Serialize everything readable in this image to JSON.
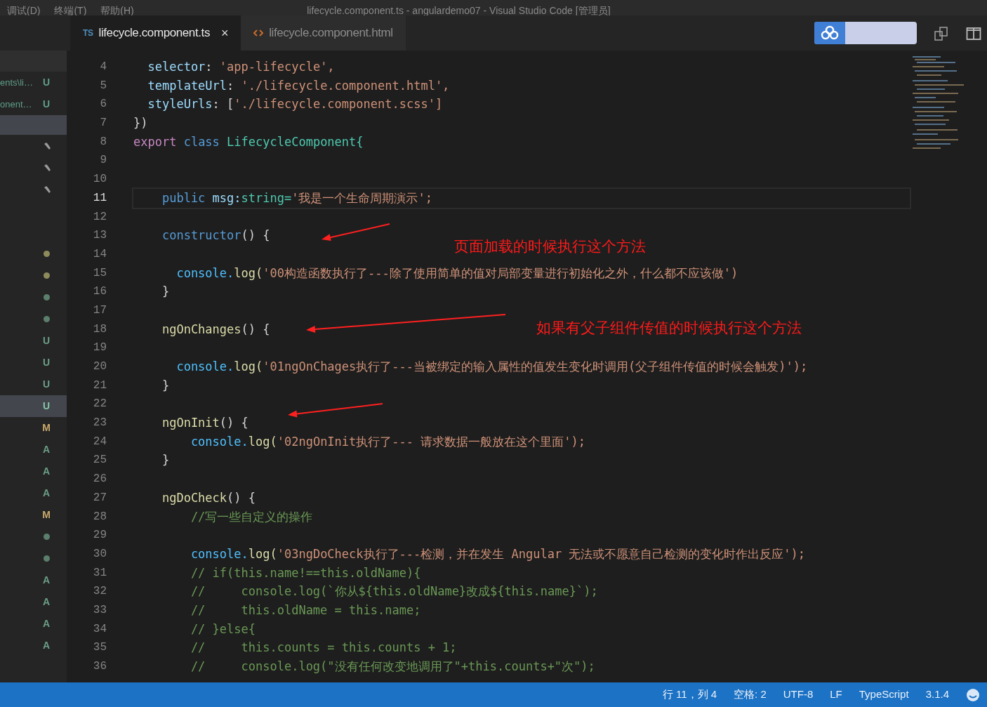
{
  "window": {
    "menus": [
      "调试(D)",
      "终端(T)",
      "帮助(H)"
    ],
    "title": "lifecycle.component.ts - angulardemo07 - Visual Studio Code [管理员]"
  },
  "tabs": [
    {
      "kind": "ts",
      "icon_text": "TS",
      "label": "lifecycle.component.ts",
      "close": "×",
      "selected": true
    },
    {
      "kind": "html",
      "label": "lifecycle.component.html",
      "selected": false
    }
  ],
  "sidebar": {
    "items": [
      {
        "kind": "file",
        "label": "ents\\li…",
        "badge": "U",
        "selected": false
      },
      {
        "kind": "file",
        "label": "onent…",
        "badge": "U",
        "selected": false
      },
      {
        "kind": "blank",
        "selected": true
      },
      {
        "kind": "icon",
        "selected": false
      },
      {
        "kind": "icon",
        "selected": false
      },
      {
        "kind": "icon",
        "selected": false
      }
    ],
    "changes": [
      {
        "kind": "dot",
        "color": "#8d8a5c",
        "selected": false
      },
      {
        "kind": "dot",
        "color": "#8d8a5c",
        "selected": false
      },
      {
        "kind": "dot",
        "color": "#5b7f6c",
        "selected": false
      },
      {
        "kind": "dot",
        "color": "#5b7f6c",
        "selected": false
      },
      {
        "kind": "letter",
        "text": "U",
        "color": "#6b9f86",
        "selected": false
      },
      {
        "kind": "letter",
        "text": "U",
        "color": "#6b9f86",
        "selected": false
      },
      {
        "kind": "letter",
        "text": "U",
        "color": "#6b9f86",
        "selected": false
      },
      {
        "kind": "letter",
        "text": "U",
        "color": "#6b9f86",
        "selected": true
      },
      {
        "kind": "letter",
        "text": "M",
        "color": "#c9a96a",
        "selected": false
      },
      {
        "kind": "letter",
        "text": "A",
        "color": "#6b9f86",
        "selected": false
      },
      {
        "kind": "letter",
        "text": "A",
        "color": "#6b9f86",
        "selected": false
      },
      {
        "kind": "letter",
        "text": "A",
        "color": "#6b9f86",
        "selected": false
      },
      {
        "kind": "letter",
        "text": "M",
        "color": "#c9a96a",
        "selected": false
      },
      {
        "kind": "dot",
        "color": "#5b7f6c",
        "selected": false
      },
      {
        "kind": "dot",
        "color": "#5b7f6c",
        "selected": false
      },
      {
        "kind": "letter",
        "text": "A",
        "color": "#6b9f86",
        "selected": false
      },
      {
        "kind": "letter",
        "text": "A",
        "color": "#6b9f86",
        "selected": false
      },
      {
        "kind": "letter",
        "text": "A",
        "color": "#6b9f86",
        "selected": false
      },
      {
        "kind": "letter",
        "text": "A",
        "color": "#6b9f86",
        "selected": false
      }
    ]
  },
  "editor": {
    "lines": [
      {
        "number": "4",
        "current": false,
        "tokens": [
          {
            "kind": "attr",
            "text": "  selector"
          },
          {
            "kind": "plain",
            "text": ": "
          },
          {
            "kind": "string",
            "text": "'app-lifecycle',"
          }
        ]
      },
      {
        "number": "5",
        "current": false,
        "tokens": [
          {
            "kind": "attr",
            "text": "  templateUrl"
          },
          {
            "kind": "plain",
            "text": ": "
          },
          {
            "kind": "string",
            "text": "'./lifecycle.component.html',"
          }
        ]
      },
      {
        "number": "6",
        "current": false,
        "tokens": [
          {
            "kind": "attr",
            "text": "  styleUrls"
          },
          {
            "kind": "plain",
            "text": ": ["
          },
          {
            "kind": "string",
            "text": "'./lifecycle.component.scss']"
          }
        ]
      },
      {
        "number": "7",
        "current": false,
        "tokens": [
          {
            "kind": "plain",
            "text": "})"
          }
        ]
      },
      {
        "number": "8",
        "current": false,
        "tokens": [
          {
            "kind": "control",
            "text": "export "
          },
          {
            "kind": "keyword",
            "text": "class "
          },
          {
            "kind": "type",
            "text": "LifecycleComponent{"
          }
        ]
      },
      {
        "number": "9",
        "current": false
      },
      {
        "number": "10",
        "current": false
      },
      {
        "number": "11",
        "current": true,
        "tokens": [
          {
            "kind": "keyword",
            "text": "    public "
          },
          {
            "kind": "attr",
            "text": "msg:"
          },
          {
            "kind": "type",
            "text": "string="
          },
          {
            "kind": "string",
            "text": "'我是一个生命周期演示';"
          }
        ]
      },
      {
        "number": "12",
        "current": false
      },
      {
        "number": "13",
        "current": false,
        "tokens": [
          {
            "kind": "keyword",
            "text": "    constructor"
          },
          {
            "kind": "plain",
            "text": "() {"
          }
        ]
      },
      {
        "number": "14",
        "current": false
      },
      {
        "number": "15",
        "current": false,
        "tokens": [
          {
            "kind": "variable",
            "text": "      console."
          },
          {
            "kind": "function",
            "text": "log("
          },
          {
            "kind": "string",
            "text": "'00构造函数执行了---除了使用简单的值对局部变量进行初始化之外，什么都不应该做')"
          }
        ]
      },
      {
        "number": "16",
        "current": false,
        "tokens": [
          {
            "kind": "plain",
            "text": "    }"
          }
        ]
      },
      {
        "number": "17",
        "current": false
      },
      {
        "number": "18",
        "current": false,
        "tokens": [
          {
            "kind": "function",
            "text": "    ngOnChanges"
          },
          {
            "kind": "plain",
            "text": "() {"
          }
        ]
      },
      {
        "number": "19",
        "current": false
      },
      {
        "number": "20",
        "current": false,
        "tokens": [
          {
            "kind": "variable",
            "text": "      console."
          },
          {
            "kind": "function",
            "text": "log("
          },
          {
            "kind": "string",
            "text": "'01ngOnChages执行了---当被绑定的输入属性的值发生变化时调用(父子组件传值的时候会触发)');"
          }
        ]
      },
      {
        "number": "21",
        "current": false,
        "tokens": [
          {
            "kind": "plain",
            "text": "    }"
          }
        ]
      },
      {
        "number": "22",
        "current": false
      },
      {
        "number": "23",
        "current": false,
        "tokens": [
          {
            "kind": "function",
            "text": "    ngOnInit"
          },
          {
            "kind": "plain",
            "text": "() {"
          }
        ]
      },
      {
        "number": "24",
        "current": false,
        "tokens": [
          {
            "kind": "variable",
            "text": "        console."
          },
          {
            "kind": "function",
            "text": "log("
          },
          {
            "kind": "string",
            "text": "'02ngOnInit执行了--- 请求数据一般放在这个里面');"
          }
        ]
      },
      {
        "number": "25",
        "current": false,
        "tokens": [
          {
            "kind": "plain",
            "text": "    }"
          }
        ]
      },
      {
        "number": "26",
        "current": false
      },
      {
        "number": "27",
        "current": false,
        "tokens": [
          {
            "kind": "function",
            "text": "    ngDoCheck"
          },
          {
            "kind": "plain",
            "text": "() {"
          }
        ]
      },
      {
        "number": "28",
        "current": false,
        "tokens": [
          {
            "kind": "comment",
            "text": "        //写一些自定义的操作"
          }
        ]
      },
      {
        "number": "29",
        "current": false
      },
      {
        "number": "30",
        "current": false,
        "tokens": [
          {
            "kind": "variable",
            "text": "        console."
          },
          {
            "kind": "function",
            "text": "log("
          },
          {
            "kind": "string",
            "text": "'03ngDoCheck执行了---检测，并在发生 Angular 无法或不愿意自己检测的变化时作出反应');"
          }
        ]
      },
      {
        "number": "31",
        "current": false,
        "tokens": [
          {
            "kind": "comment",
            "text": "        // if(this.name!==this.oldName){"
          }
        ]
      },
      {
        "number": "32",
        "current": false,
        "tokens": [
          {
            "kind": "comment",
            "text": "        //     console.log(`你从${this.oldName}改成${this.name}`);"
          }
        ]
      },
      {
        "number": "33",
        "current": false,
        "tokens": [
          {
            "kind": "comment",
            "text": "        //     this.oldName = this.name;"
          }
        ]
      },
      {
        "number": "34",
        "current": false,
        "tokens": [
          {
            "kind": "comment",
            "text": "        // }else{"
          }
        ]
      },
      {
        "number": "35",
        "current": false,
        "tokens": [
          {
            "kind": "comment",
            "text": "        //     this.counts = this.counts + 1;"
          }
        ]
      },
      {
        "number": "36",
        "current": false,
        "tokens": [
          {
            "kind": "comment",
            "text": "        //     console.log(\"没有任何改变地调用了\"+this.counts+\"次\");"
          }
        ]
      }
    ]
  },
  "annotations": [
    {
      "kind": "arrow"
    },
    {
      "kind": "label",
      "text": "页面加载的时候执行这个方法"
    },
    {
      "kind": "arrow"
    },
    {
      "kind": "label",
      "text": "如果有父子组件传值的时候执行这个方法"
    },
    {
      "kind": "arrow"
    }
  ],
  "status_bar": [
    "行 11，列 4",
    "空格: 2",
    "UTF-8",
    "LF",
    "TypeScript",
    "3.1.4"
  ]
}
